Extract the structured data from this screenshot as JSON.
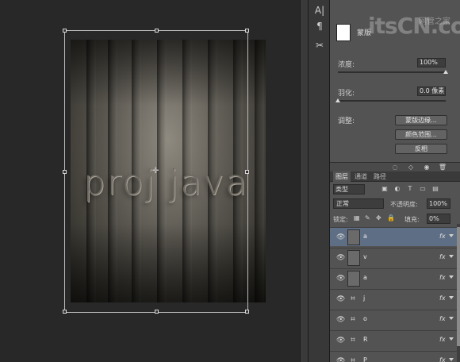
{
  "tools": {
    "text_tool_label": "A|",
    "paragraph_tool_label": "¶",
    "scissor_icon": "scissor-icon"
  },
  "canvas": {
    "artwork_text": "proj java"
  },
  "properties": {
    "title": "蒙版",
    "density_label": "浓度:",
    "density_value": "100%",
    "density_level": 1.0,
    "feather_label": "羽化:",
    "feather_value": "0.0 像素",
    "feather_level": 0.0,
    "adjust_label": "调整:",
    "refine_edge_button": "蒙版边缘...",
    "color_range_button": "颜色范围...",
    "invert_button": "反相"
  },
  "layers_panel": {
    "tabs": [
      "图层",
      "通道",
      "路径"
    ],
    "filter_kind": "类型",
    "blend_mode": "正常",
    "opacity_label": "不透明度:",
    "opacity_value": "100%",
    "lock_label": "锁定:",
    "fill_label": "填充:",
    "fill_value": "0%",
    "layers": [
      {
        "name": "a",
        "kind": "image",
        "selected": true,
        "fx": "fx"
      },
      {
        "name": "v",
        "kind": "image",
        "selected": false,
        "fx": "fx"
      },
      {
        "name": "a",
        "kind": "image",
        "selected": false,
        "fx": "fx"
      },
      {
        "name": "j",
        "kind": "text",
        "selected": false,
        "fx": "fx"
      },
      {
        "name": "o",
        "kind": "text",
        "selected": false,
        "fx": "fx"
      },
      {
        "name": "R",
        "kind": "text",
        "selected": false,
        "fx": "fx"
      },
      {
        "name": "P",
        "kind": "text",
        "selected": false,
        "fx": "fx"
      }
    ]
  },
  "watermark": {
    "logo": "itsCN.com",
    "sub": "网管之家"
  },
  "colors": {
    "panel_bg": "#535353",
    "selected_layer": "#5e6e84",
    "workspace_bg": "#282828"
  }
}
